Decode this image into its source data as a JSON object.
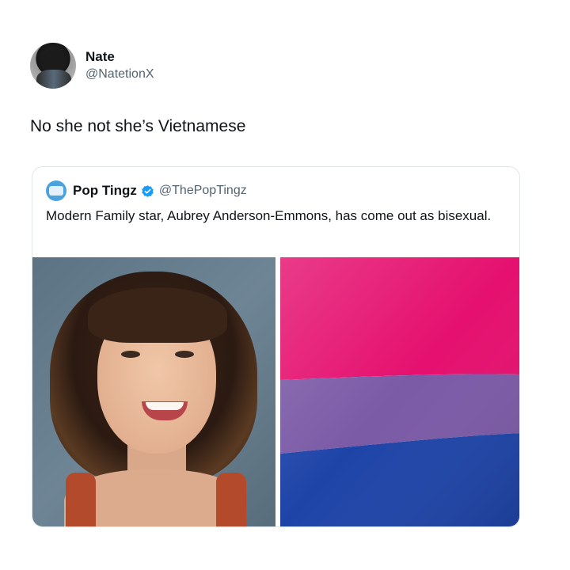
{
  "tweet": {
    "author": {
      "display_name": "Nate",
      "handle": "@NatetionX"
    },
    "text": "No she not she’s Vietnamese"
  },
  "quoted_tweet": {
    "author": {
      "display_name": "Pop Tingz",
      "handle": "@ThePopTingz",
      "verified": true
    },
    "text": "Modern Family star, Aubrey Anderson-Emmons, has come out as bisexual.",
    "media": [
      {
        "kind": "photo",
        "icon": "portrait-photo"
      },
      {
        "kind": "flag",
        "icon": "bisexual-pride-flag",
        "colors": [
          "#e5106f",
          "#7b5aa6",
          "#1e44a8"
        ]
      }
    ]
  },
  "colors": {
    "verified_badge": "#1d9bf0",
    "secondary_text": "#536471"
  }
}
